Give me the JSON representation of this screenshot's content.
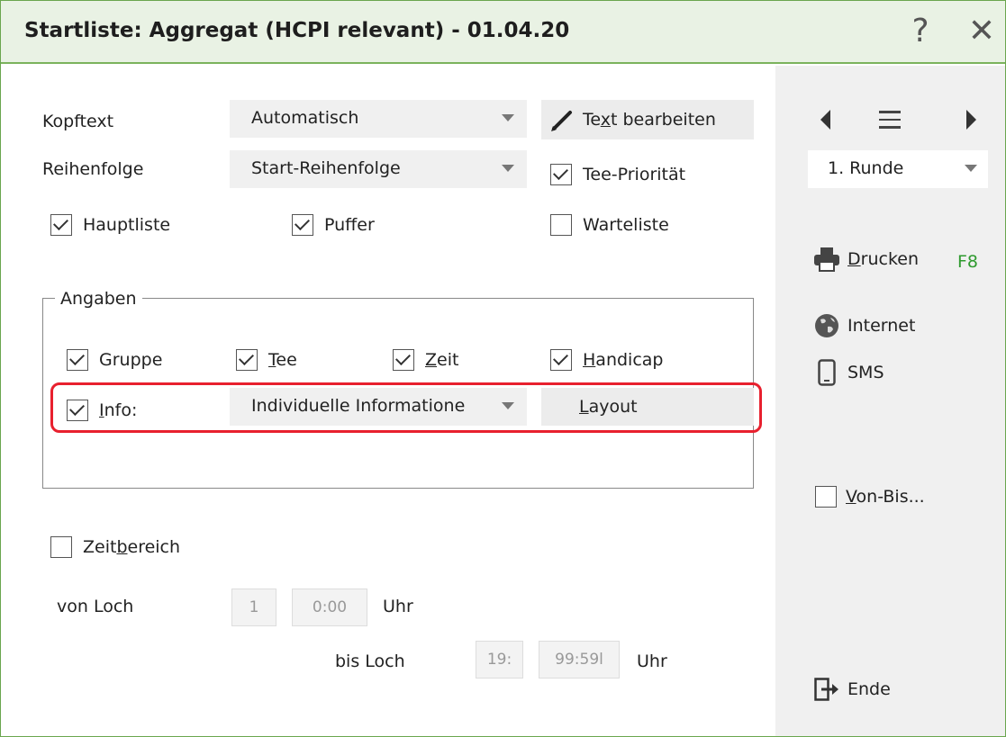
{
  "window": {
    "title": "Startliste: Aggregat (HCPI relevant) - 01.04.20",
    "help_glyph": "?",
    "close_glyph": "✕"
  },
  "form": {
    "kopftext": {
      "label": "Kopftext",
      "value": "Automatisch"
    },
    "text_bearbeiten": {
      "pre": "Te",
      "underlined": "x",
      "post": "t bearbeiten"
    },
    "reihenfolge": {
      "label": "Reihenfolge",
      "value": "Start-Reihenfolge"
    },
    "tee_prioritaet": {
      "label": "Tee-Priorität",
      "checked": true
    },
    "hauptliste": {
      "label": "Hauptliste",
      "checked": true
    },
    "puffer": {
      "label": "Puffer",
      "checked": true
    },
    "warteliste": {
      "label": "Warteliste",
      "checked": false
    }
  },
  "angaben": {
    "legend": "Angaben",
    "gruppe": {
      "label": "Gruppe",
      "checked": true
    },
    "tee": {
      "underlined": "T",
      "rest": "ee",
      "checked": true
    },
    "zeit": {
      "underlined": "Z",
      "rest": "eit",
      "checked": true
    },
    "handicap": {
      "underlined": "H",
      "rest": "andicap",
      "checked": true
    },
    "info": {
      "underlined": "I",
      "rest": "nfo:",
      "checked": true
    },
    "info_combo": "Individuelle Informatione",
    "layout": {
      "underlined": "L",
      "rest": "ayout"
    }
  },
  "zeitbereich": {
    "pre": "Zeit",
    "underlined": "b",
    "post": "ereich",
    "checked": false
  },
  "range": {
    "von_loch_label": "von Loch",
    "von_loch_value": "1",
    "von_time": "0:00",
    "uhr1": "Uhr",
    "bis_loch_label": "bis Loch",
    "bis_loch_value": "19:",
    "bis_time": "99:59l",
    "uhr2": "Uhr"
  },
  "side": {
    "runde": "1. Runde",
    "drucken": {
      "underlined": "D",
      "rest": "rucken",
      "shortcut": "F8",
      "shortcut_color": "#2e9a2e"
    },
    "internet": "Internet",
    "sms": "SMS",
    "von_bis": {
      "underlined": "V",
      "rest": "on-Bis...",
      "checked": false
    },
    "ende": "Ende"
  },
  "colors": {
    "accent_green": "#7bb35c",
    "highlight_red": "#e8202e",
    "title_bg": "#e9f2e4"
  }
}
